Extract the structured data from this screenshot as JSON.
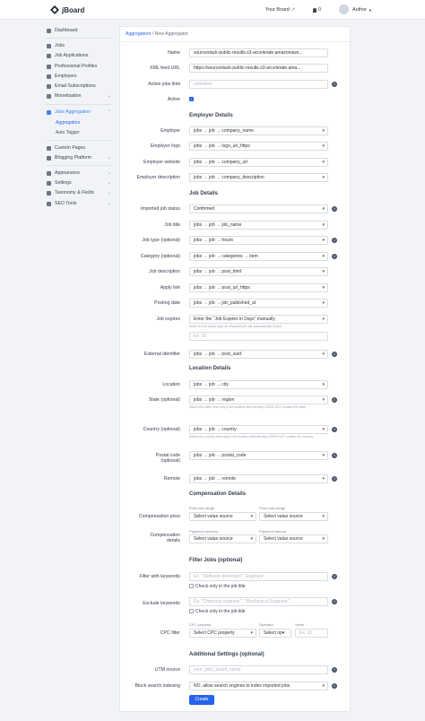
{
  "topbar": {
    "logo": "jBoard",
    "your_board": "Your Board",
    "external_icon": "↗",
    "notif_count": "0",
    "author": "Author"
  },
  "sidebar": {
    "items": [
      {
        "label": "Dashboard",
        "icon": "dashboard-icon"
      },
      {
        "label": "Jobs",
        "icon": "briefcase-icon"
      },
      {
        "label": "Job Applications",
        "icon": "file-icon"
      },
      {
        "label": "Professional Profiles",
        "icon": "user-icon"
      },
      {
        "label": "Employers",
        "icon": "building-icon"
      },
      {
        "label": "Email Subscriptions",
        "icon": "mail-icon"
      },
      {
        "label": "Monetization",
        "icon": "dollar-icon"
      },
      {
        "label": "Jobs Aggregation",
        "icon": "layers-icon"
      },
      {
        "label": "Aggregators"
      },
      {
        "label": "Auto Tagger"
      },
      {
        "label": "Custom Pages",
        "icon": "page-icon"
      },
      {
        "label": "Blogging Platform",
        "icon": "edit-icon"
      },
      {
        "label": "Appearance",
        "icon": "brush-icon"
      },
      {
        "label": "Settings",
        "icon": "gear-icon"
      },
      {
        "label": "Taxonomy & Fields",
        "icon": "tag-icon"
      },
      {
        "label": "SEO Tools",
        "icon": "search-icon"
      }
    ]
  },
  "breadcrumb": {
    "parent": "Aggregators",
    "separator": "/",
    "current": "New Aggregator"
  },
  "form": {
    "name": {
      "label": "Name",
      "value": "sourcestack-public-results.s3-accelerate.amazonaws..."
    },
    "xml_feed": {
      "label": "XML feed URL",
      "value": "https://sourcestack-public-results.s3-accelerate.ama..."
    },
    "active_limit": {
      "label": "Active jobs limit",
      "placeholder": "unlimited"
    },
    "active": {
      "label": "Active"
    },
    "employer_section": "Employer Details",
    "employer": {
      "label": "Employer",
      "value": "jobs → job → company_name"
    },
    "employer_logo": {
      "label": "Employer logo",
      "value": "jobs → job → logo_url_https"
    },
    "employer_website": {
      "label": "Employer website",
      "value": "jobs → job → company_url"
    },
    "employer_description": {
      "label": "Employer description",
      "value": "jobs → job → company_description"
    },
    "job_section": "Job Details",
    "imported_status": {
      "label": "Imported job status",
      "value": "Confirmed"
    },
    "job_title": {
      "label": "Job title",
      "value": "jobs → job → job_name"
    },
    "job_type": {
      "label": "Job type (optional)",
      "value": "jobs → job → hours"
    },
    "category": {
      "label": "Category (optional)",
      "value": "jobs → job → categories → item"
    },
    "job_description": {
      "label": "Job description",
      "value": "jobs → job → post_html"
    },
    "apply_link": {
      "label": "Apply link",
      "value": "jobs → job → post_url_https"
    },
    "posting_date": {
      "label": "Posting date",
      "value": "jobs → job → job_published_at"
    },
    "job_expires": {
      "label": "Job expires",
      "value": "Enter the \"Job Expires in Days\" manually",
      "help": "Enter in how many days an imported job will automatically expire",
      "days_placeholder": "Ex. 30"
    },
    "external_id": {
      "label": "External identifier",
      "value": "jobs → job → post_uuid"
    },
    "location_section": "Location Details",
    "location": {
      "label": "Location",
      "value": "jobs → job → city"
    },
    "state": {
      "label": "State (optional)",
      "value": "jobs → job → region",
      "help": "Select the state here only if the location field already DOES NOT contain the state"
    },
    "country": {
      "label": "Country (optional)",
      "value": "jobs → job → country",
      "help": "Select the country here only if the location field already DOES NOT contain the country"
    },
    "postal_code": {
      "label_1": "Postal code",
      "label_2": "(optional)",
      "value": "jobs → job → postal_code"
    },
    "remote": {
      "label": "Remote",
      "value": "jobs → job → remote"
    },
    "compensation_section": "Compensation Details",
    "price_min_label": "Price min range",
    "price_max_label": "Price max range",
    "compensation_price": {
      "label": "Compensation price",
      "min": "Select value source",
      "max": "Select value source"
    },
    "payment_currency_label": "Payment currency",
    "payment_interval_label": "Payment interval",
    "compensation_details": {
      "label_1": "Compensation",
      "label_2": "details",
      "currency": "Select value source",
      "interval": "Select value source"
    },
    "filter_section": "Filter Jobs (optional)",
    "filter_keywords": {
      "label": "Filter with keywords",
      "placeholder": "Ex. \"Software developer\", Engineer",
      "check": "Check only in the job title"
    },
    "exclude_keywords": {
      "label": "Exclude keywords",
      "placeholder": "Ex. \"Chemical engineer\", \"Mechanical Engineer\"",
      "check": "Check only in the job title"
    },
    "cpc_filter": {
      "label": "CPC filter",
      "property_label": "CPC property",
      "operator_label": "Operator",
      "value_label": "Value",
      "property": "Select CPC property",
      "operator": "Select op▾",
      "value_placeholder": "Ex. 15"
    },
    "additional_section": "Additional Settings (optional)",
    "utm_source": {
      "label": "UTM source",
      "placeholder": "your_jobs_board_name"
    },
    "block_indexing": {
      "label": "Block search indexing",
      "value": "NO, allow search engines to index imported jobs"
    },
    "create_button": "Create"
  }
}
